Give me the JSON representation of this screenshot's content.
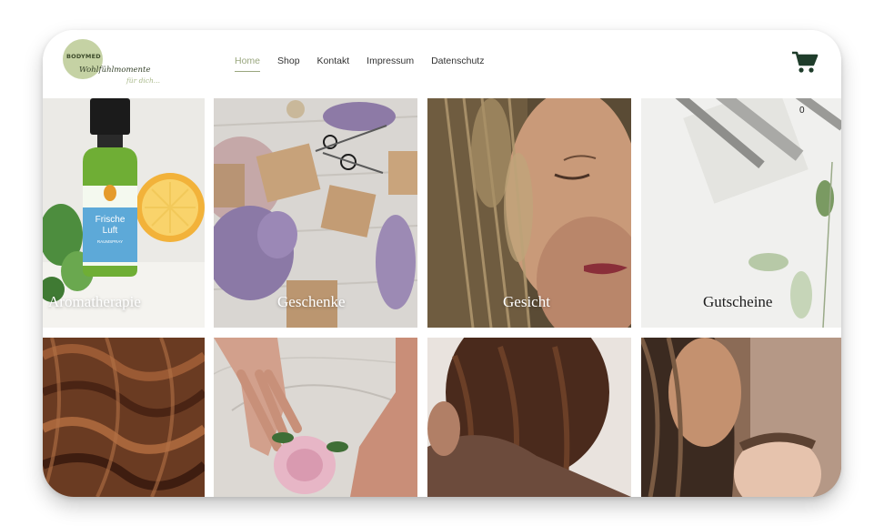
{
  "brand": {
    "logo_mark": "BODYMED",
    "tagline_1": "Wohlfühlmomente",
    "tagline_2": "für dich..."
  },
  "nav": {
    "items": [
      {
        "label": "Home",
        "active": true
      },
      {
        "label": "Shop",
        "active": false
      },
      {
        "label": "Kontakt",
        "active": false
      },
      {
        "label": "Impressum",
        "active": false
      },
      {
        "label": "Datenschutz",
        "active": false
      }
    ]
  },
  "cart": {
    "icon": "shopping-cart-icon",
    "count": "0",
    "color": "#1f3d2b"
  },
  "product_text": {
    "name_1": "Frische",
    "name_2": "Luft",
    "sub": "RAUMSPRAY"
  },
  "categories": [
    {
      "label": "Aromatherapie"
    },
    {
      "label": "Geschenke"
    },
    {
      "label": "Gesicht"
    },
    {
      "label": "Gutscheine"
    },
    {
      "label": ""
    },
    {
      "label": ""
    },
    {
      "label": ""
    },
    {
      "label": ""
    }
  ],
  "colors": {
    "accent": "#9aa77f",
    "nav_text": "#333333",
    "logo_circle": "#c5d2a4"
  }
}
